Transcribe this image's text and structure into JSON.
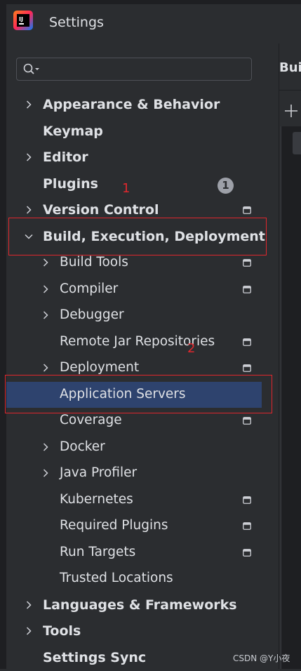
{
  "window": {
    "title": "Settings"
  },
  "search": {
    "value": ""
  },
  "right_pane": {
    "header_partial": "Bui"
  },
  "tree": [
    {
      "label": "Appearance & Behavior",
      "level": 0,
      "expandable": true,
      "expanded": false,
      "project_icon": false
    },
    {
      "label": "Keymap",
      "level": 0,
      "expandable": false,
      "project_icon": false
    },
    {
      "label": "Editor",
      "level": 0,
      "expandable": true,
      "expanded": false,
      "project_icon": false
    },
    {
      "label": "Plugins",
      "level": 0,
      "expandable": false,
      "project_icon": false,
      "badge": "1"
    },
    {
      "label": "Version Control",
      "level": 0,
      "expandable": true,
      "expanded": false,
      "project_icon": true
    },
    {
      "label": "Build, Execution, Deployment",
      "level": 0,
      "expandable": true,
      "expanded": true,
      "project_icon": false
    },
    {
      "label": "Build Tools",
      "level": 1,
      "expandable": true,
      "expanded": false,
      "project_icon": true
    },
    {
      "label": "Compiler",
      "level": 1,
      "expandable": true,
      "expanded": false,
      "project_icon": true
    },
    {
      "label": "Debugger",
      "level": 1,
      "expandable": true,
      "expanded": false,
      "project_icon": false
    },
    {
      "label": "Remote Jar Repositories",
      "level": 1,
      "expandable": false,
      "project_icon": true
    },
    {
      "label": "Deployment",
      "level": 1,
      "expandable": true,
      "expanded": false,
      "project_icon": true
    },
    {
      "label": "Application Servers",
      "level": 1,
      "expandable": false,
      "project_icon": false,
      "selected": true
    },
    {
      "label": "Coverage",
      "level": 1,
      "expandable": false,
      "project_icon": true
    },
    {
      "label": "Docker",
      "level": 1,
      "expandable": true,
      "expanded": false,
      "project_icon": false
    },
    {
      "label": "Java Profiler",
      "level": 1,
      "expandable": true,
      "expanded": false,
      "project_icon": false
    },
    {
      "label": "Kubernetes",
      "level": 1,
      "expandable": false,
      "project_icon": true
    },
    {
      "label": "Required Plugins",
      "level": 1,
      "expandable": false,
      "project_icon": true
    },
    {
      "label": "Run Targets",
      "level": 1,
      "expandable": false,
      "project_icon": true
    },
    {
      "label": "Trusted Locations",
      "level": 1,
      "expandable": false,
      "project_icon": false
    },
    {
      "label": "Languages & Frameworks",
      "level": 0,
      "expandable": true,
      "expanded": false,
      "project_icon": false
    },
    {
      "label": "Tools",
      "level": 0,
      "expandable": true,
      "expanded": false,
      "project_icon": false
    },
    {
      "label": "Settings Sync",
      "level": 0,
      "expandable": false,
      "project_icon": false
    }
  ],
  "annotations": {
    "label_1": "1",
    "label_2": "2",
    "color": "#e0272d"
  },
  "watermark": "CSDN @Y小夜",
  "colors": {
    "background": "#2b2d30",
    "selection": "#2e436e",
    "text": "#dfe1e5"
  }
}
